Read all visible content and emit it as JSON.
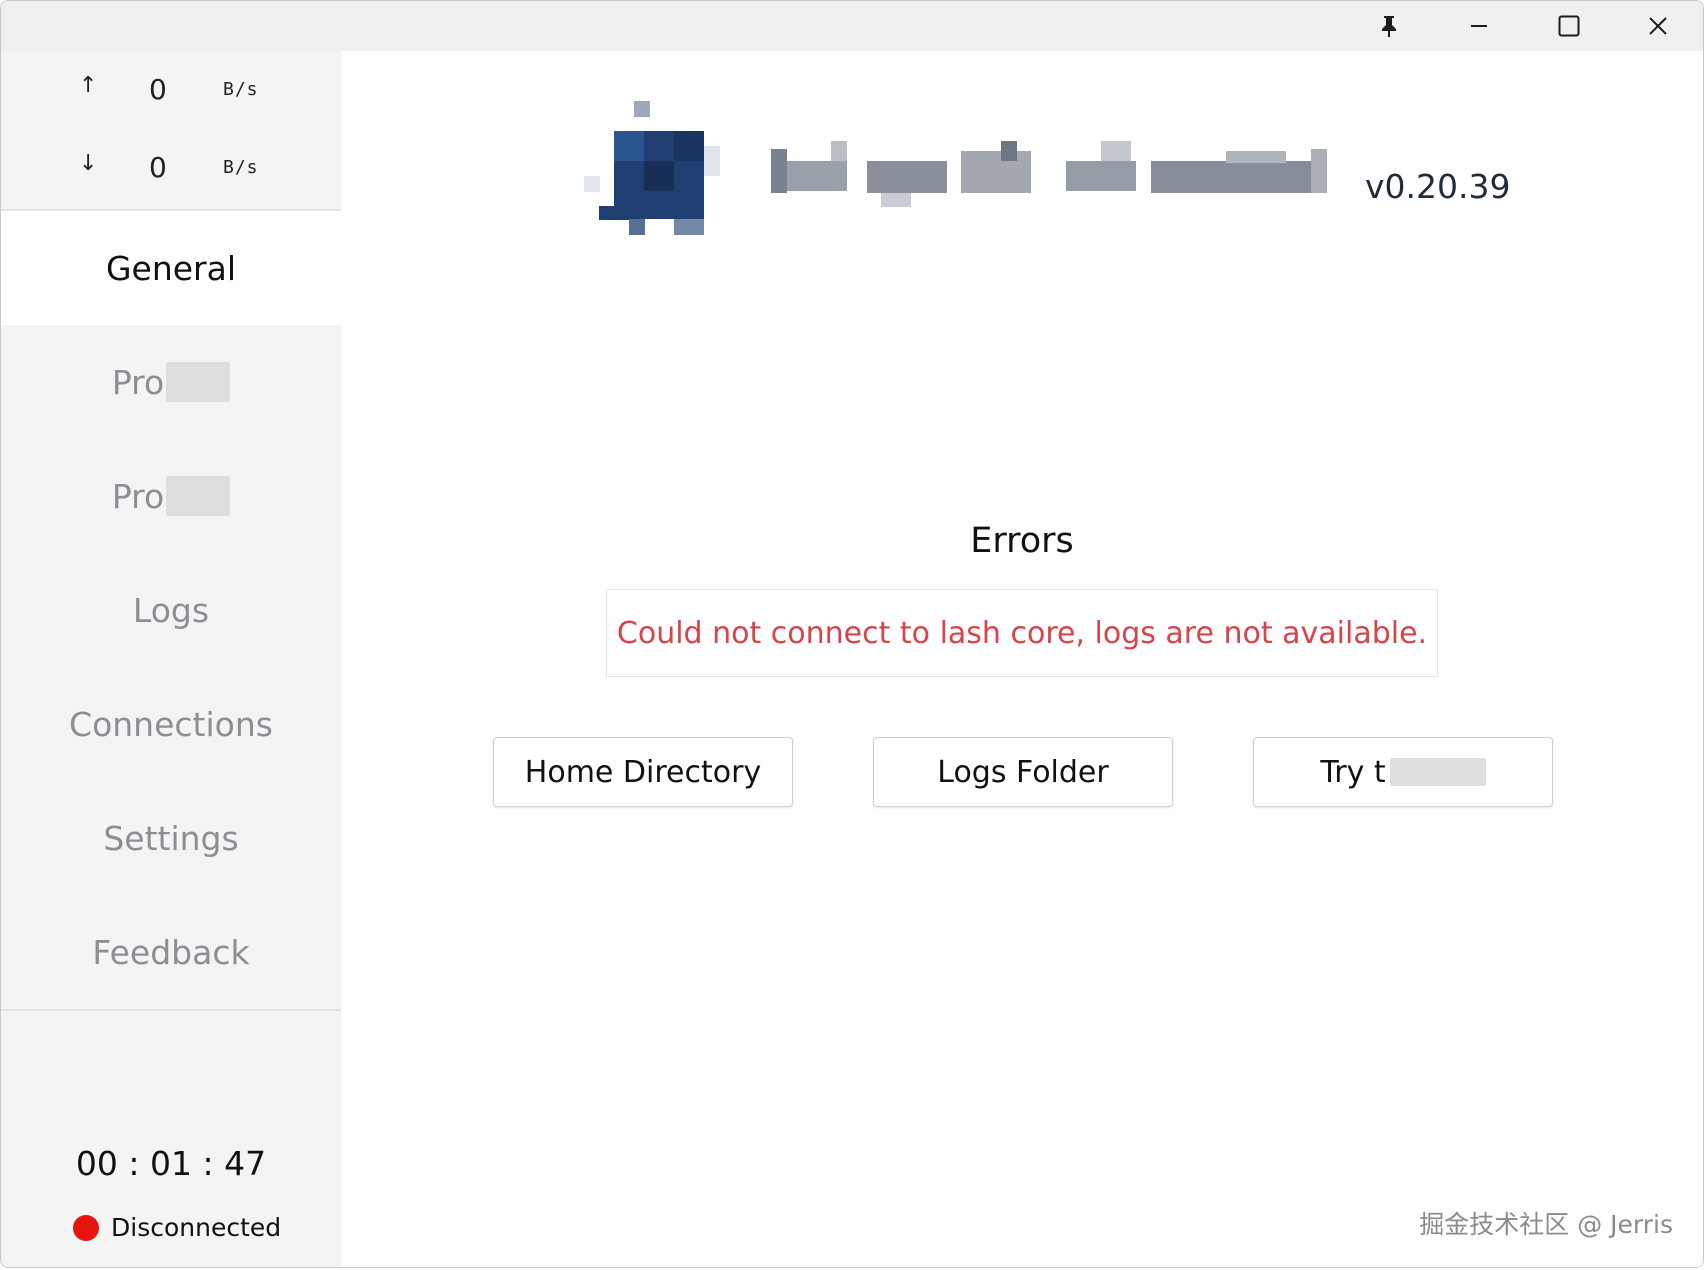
{
  "titlebar": {
    "pin_icon": "pin-icon",
    "minimize_icon": "minimize-icon",
    "maximize_icon": "maximize-icon",
    "close_icon": "close-icon"
  },
  "traffic": {
    "upload_arrow": "↑",
    "upload_value": "0",
    "upload_unit": "B/s",
    "download_arrow": "↓",
    "download_value": "0",
    "download_unit": "B/s"
  },
  "nav": {
    "general": "General",
    "proxies": "Pro",
    "profiles": "Pro",
    "logs": "Logs",
    "connections": "Connections",
    "settings": "Settings",
    "feedback": "Feedback"
  },
  "timer": "00 : 01 : 47",
  "status": {
    "label": "Disconnected",
    "dot_color": "#e8140f"
  },
  "header": {
    "version": "v0.20.39"
  },
  "errors": {
    "title": "Errors",
    "message": "Could not connect to  lash core, logs are not available."
  },
  "buttons": {
    "home_directory": "Home Directory",
    "logs_folder": "Logs Folder",
    "try": "Try t"
  },
  "watermark": "掘金技术社区 @ Jerris",
  "colors": {
    "accent_logo": "#1f3f72",
    "error_text": "#d9434a",
    "sidebar_bg": "#f4f4f4"
  }
}
